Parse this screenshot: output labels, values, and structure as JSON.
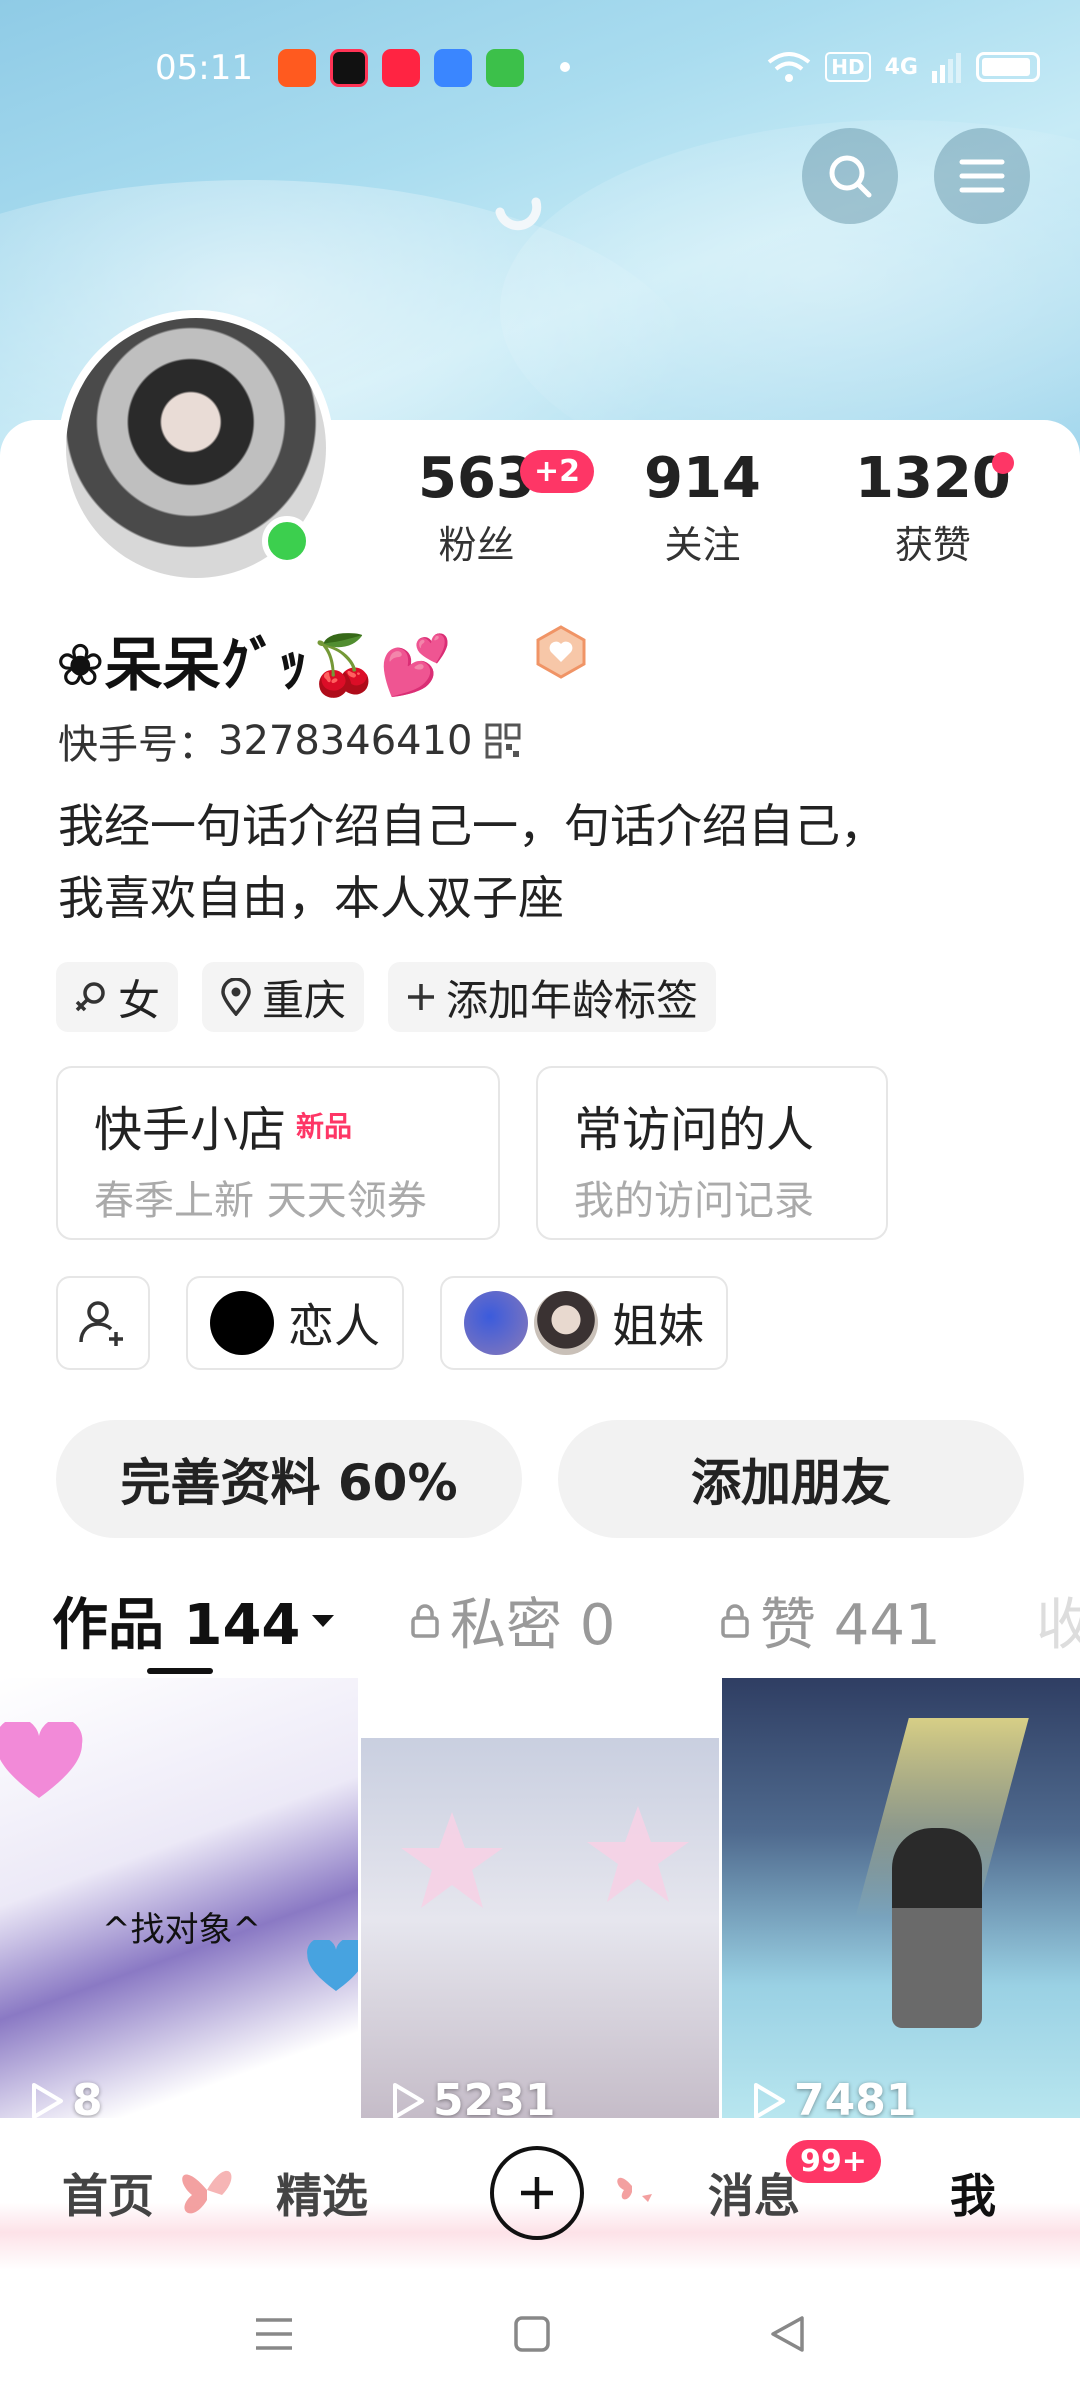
{
  "status_bar": {
    "time": "05:11",
    "hd": "HD",
    "network": "4G"
  },
  "header": {
    "search_icon": "search-icon",
    "menu_icon": "menu-icon"
  },
  "stats": [
    {
      "value": "563",
      "label": "粉丝",
      "badge": "+2"
    },
    {
      "value": "914",
      "label": "关注"
    },
    {
      "value": "1320",
      "label": "获赞"
    }
  ],
  "profile": {
    "nickname": "❀呆呆ｸﾞｯ🍒💕",
    "kuaishou_id_label": "快手号：",
    "kuaishou_id": "3278346410",
    "bio_line1": "我经一句话介绍自己一，句话介绍自己，",
    "bio_line2": "我喜欢自由，本人双子座"
  },
  "tags": {
    "gender": "女",
    "location": "重庆",
    "add_age": "添加年龄标签"
  },
  "boxes": {
    "shop_title": "快手小店",
    "shop_badge": "新品",
    "shop_sub": "春季上新 天天领券",
    "visitors_title": "常访问的人",
    "visitors_sub": "我的访问记录"
  },
  "relations": {
    "lover": "恋人",
    "sisters": "姐妹"
  },
  "actions": {
    "complete_profile": "完善资料 60%",
    "add_friend": "添加朋友"
  },
  "tabs": {
    "works": "作品 144",
    "private": "私密 0",
    "likes": "赞 441",
    "collect": "收"
  },
  "videos": [
    {
      "plays": "8",
      "caption": "^找对象^"
    },
    {
      "plays": "5231"
    },
    {
      "plays": "7481"
    }
  ],
  "bottom_nav": {
    "home": "首页",
    "featured": "精选",
    "messages": "消息",
    "messages_badge": "99+",
    "me": "我"
  }
}
